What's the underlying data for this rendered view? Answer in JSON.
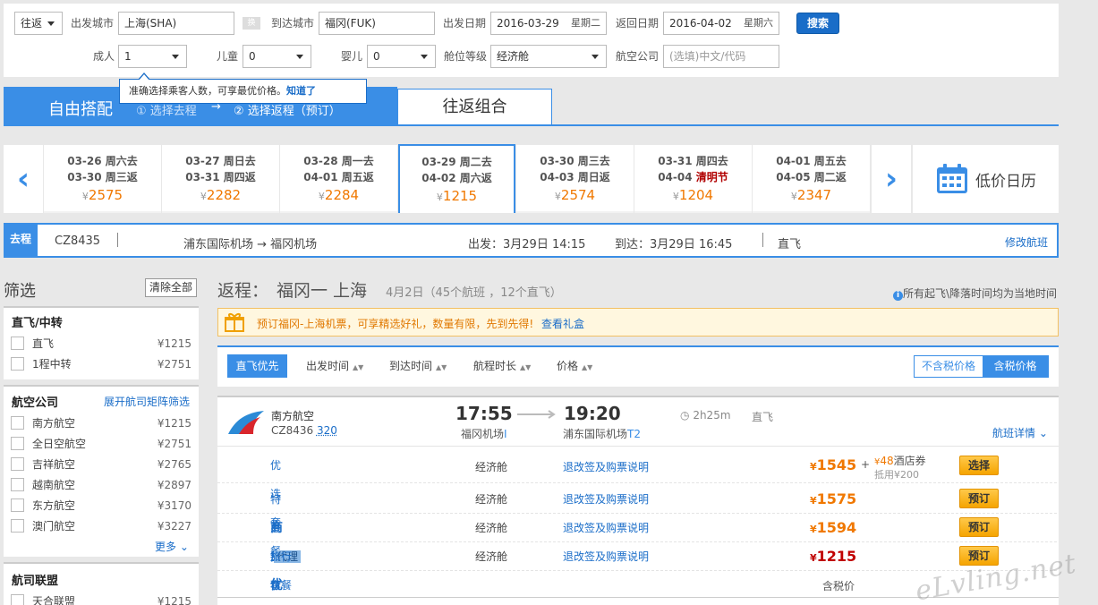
{
  "search": {
    "trip_type": "往返",
    "from_label": "出发城市",
    "from_value": "上海(SHA)",
    "swap_label": "换",
    "to_label": "到达城市",
    "to_value": "福冈(FUK)",
    "depart_label": "出发日期",
    "depart_date": "2016-03-29",
    "depart_weekday": "星期二",
    "return_label": "返回日期",
    "return_date": "2016-04-02",
    "return_weekday": "星期六",
    "search_button": "搜索",
    "adult_label": "成人",
    "adult_value": "1",
    "child_label": "儿童",
    "child_value": "0",
    "infant_label": "婴儿",
    "infant_value": "0",
    "cabin_label": "舱位等级",
    "cabin_value": "经济舱",
    "airline_label": "航空公司",
    "airline_placeholder": "(选填)中文/代码",
    "tip_text": "准确选择乘客人数，可享最优价格。",
    "tip_link": "知道了"
  },
  "tabs": {
    "free": "自由搭配",
    "step1": "① 选择去程",
    "arrow": "→",
    "step2": "② 选择返程（预订）",
    "combo": "往返组合"
  },
  "dates": [
    {
      "l1": "03-26 周六去",
      "l2a": "03-30 周三返",
      "hol": "",
      "price": "2575"
    },
    {
      "l1": "03-27 周日去",
      "l2a": "03-31 周四返",
      "hol": "",
      "price": "2282"
    },
    {
      "l1": "03-28 周一去",
      "l2a": "04-01 周五返",
      "hol": "",
      "price": "2284"
    },
    {
      "l1": "03-29 周二去",
      "l2a": "04-02 周六返",
      "hol": "",
      "price": "1215"
    },
    {
      "l1": "03-30 周三去",
      "l2a": "04-03 周日返",
      "hol": "",
      "price": "2574"
    },
    {
      "l1": "03-31 周四去",
      "l2a": "04-04 ",
      "hol": "清明节",
      "price": "1204"
    },
    {
      "l1": "04-01 周五去",
      "l2a": "04-05 周二返",
      "hol": "",
      "price": "2347"
    }
  ],
  "currency": "¥",
  "calendar_label": "低价日历",
  "outbound": {
    "tag": "去程",
    "flight": "CZ8435",
    "route": "浦东国际机场 → 福冈机场",
    "depart": "出发：3月29日 14:15",
    "arrive": "到达：3月29日 16:45",
    "type": "直飞",
    "modify": "修改航班"
  },
  "filter": {
    "title": "筛选",
    "clear": "清除全部",
    "stops_head": "直飞/中转",
    "stops": [
      {
        "name": "直飞",
        "price": "¥1215"
      },
      {
        "name": "1程中转",
        "price": "¥2751"
      }
    ],
    "airline_head": "航空公司",
    "airline_link": "展开航司矩阵筛选",
    "airlines": [
      {
        "name": "南方航空",
        "price": "¥1215"
      },
      {
        "name": "全日空航空",
        "price": "¥2751"
      },
      {
        "name": "吉祥航空",
        "price": "¥2765"
      },
      {
        "name": "越南航空",
        "price": "¥2897"
      },
      {
        "name": "东方航空",
        "price": "¥3170"
      },
      {
        "name": "澳门航空",
        "price": "¥3227"
      }
    ],
    "more": "更多",
    "alliance_head": "航司联盟",
    "alliances": [
      {
        "name": "天合联盟",
        "price": "¥1215"
      }
    ]
  },
  "result": {
    "title_prefix": "返程：",
    "title_route": "福冈一 上海",
    "subtitle": "4月2日（45个航班 ，12个直飞）",
    "note": "所有起飞\\降落时间均为当地时间",
    "promo": "预订福冈-上海机票，可享精选好礼，数量有限，先到先得!",
    "promo_link": "查看礼盒",
    "sort": {
      "direct": "直飞优先",
      "dep": "出发时间",
      "arr": "到达时间",
      "dur": "航程时长",
      "price": "价格",
      "no_tax": "不含税价格",
      "with_tax": "含税价格"
    },
    "flight": {
      "airline": "南方航空",
      "code": "CZ8436",
      "plane": "320",
      "dep_time": "17:55",
      "dep_airport": "福冈机场",
      "dep_term": "I",
      "arr_time": "19:20",
      "arr_airport": "浦东国际机场",
      "arr_term": "T2",
      "duration": "2h25m",
      "type": "直飞",
      "details": "航班详情"
    },
    "fares": [
      {
        "name": "优选套餐",
        "cabin": "经济舱",
        "rules": "退改签及购票说明",
        "price": "1545",
        "btn": "选择"
      },
      {
        "name": "特惠推荐",
        "cabin": "经济舱",
        "rules": "退改签及购票说明",
        "price": "1575",
        "btn": "预订"
      },
      {
        "name": "商务优选",
        "cabin": "经济舱",
        "rules": "退改签及购票说明",
        "price": "1594",
        "btn": "预订"
      },
      {
        "name": "旅行套餐",
        "tag": "代理",
        "cabin": "经济舱",
        "rules": "退改签及购票说明",
        "price": "1215",
        "btn": "预订"
      }
    ],
    "bonus_plus": "+",
    "bonus_cur": "¥",
    "bonus_amount": "48",
    "bonus_text": "酒店券",
    "bonus_sub": "抵用¥200",
    "tax_note": "含税价",
    "watermark": "eLvling.net"
  }
}
